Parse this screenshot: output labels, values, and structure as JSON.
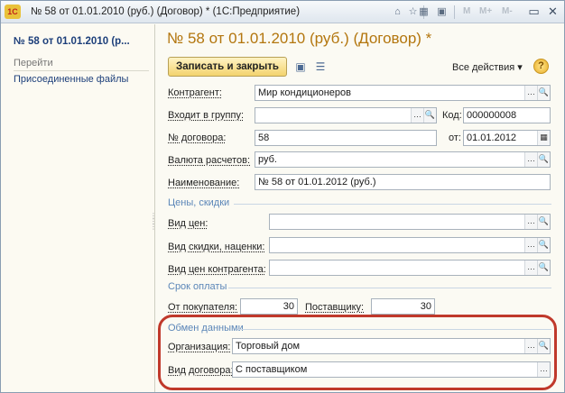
{
  "window": {
    "title": "№ 58 от 01.01.2010 (руб.) (Договор) * (1С:Предприятие)",
    "app_logo": "1С",
    "toolbar_m": [
      "M",
      "M+",
      "M-"
    ]
  },
  "left_panel": {
    "doc_link": "№ 58 от 01.01.2010 (р...",
    "nav_header": "Перейти",
    "nav_items": [
      "Присоединенные файлы"
    ]
  },
  "form": {
    "title": "№ 58 от 01.01.2010 (руб.) (Договор) *",
    "save_close_button": "Записать и закрыть",
    "all_actions": "Все действия ▾",
    "help": "?",
    "fields": {
      "counterparty": {
        "label": "Контрагент:",
        "value": "Мир кондиционеров"
      },
      "group": {
        "label": "Входит в группу:",
        "value": ""
      },
      "code": {
        "label": "Код:",
        "value": "000000008"
      },
      "contract_no": {
        "label": "№ договора:",
        "value": "58"
      },
      "date": {
        "label": "от:",
        "value": "01.01.2012"
      },
      "currency": {
        "label": "Валюта расчетов:",
        "value": "руб."
      },
      "name": {
        "label": "Наименование:",
        "value": "№ 58 от 01.01.2012 (руб.)"
      }
    },
    "prices_group": {
      "title": "Цены, скидки",
      "price_type": {
        "label": "Вид цен:",
        "value": ""
      },
      "discount_type": {
        "label": "Вид скидки, наценки:",
        "value": ""
      },
      "counterparty_price_type": {
        "label": "Вид цен контрагента:",
        "value": ""
      }
    },
    "payment_group": {
      "title": "Срок оплаты",
      "from_buyer": {
        "label": "От покупателя:",
        "value": "30"
      },
      "to_supplier": {
        "label": "Поставщику:",
        "value": "30"
      }
    },
    "exchange_group": {
      "title": "Обмен данными",
      "organization": {
        "label": "Организация:",
        "value": "Торговый дом"
      },
      "contract_type": {
        "label": "Вид договора:",
        "value": "С поставщиком"
      }
    }
  },
  "colors": {
    "title": "#b3760e",
    "link": "#1d3f7a",
    "group": "#5b86b8",
    "highlight": "#c0392b"
  }
}
